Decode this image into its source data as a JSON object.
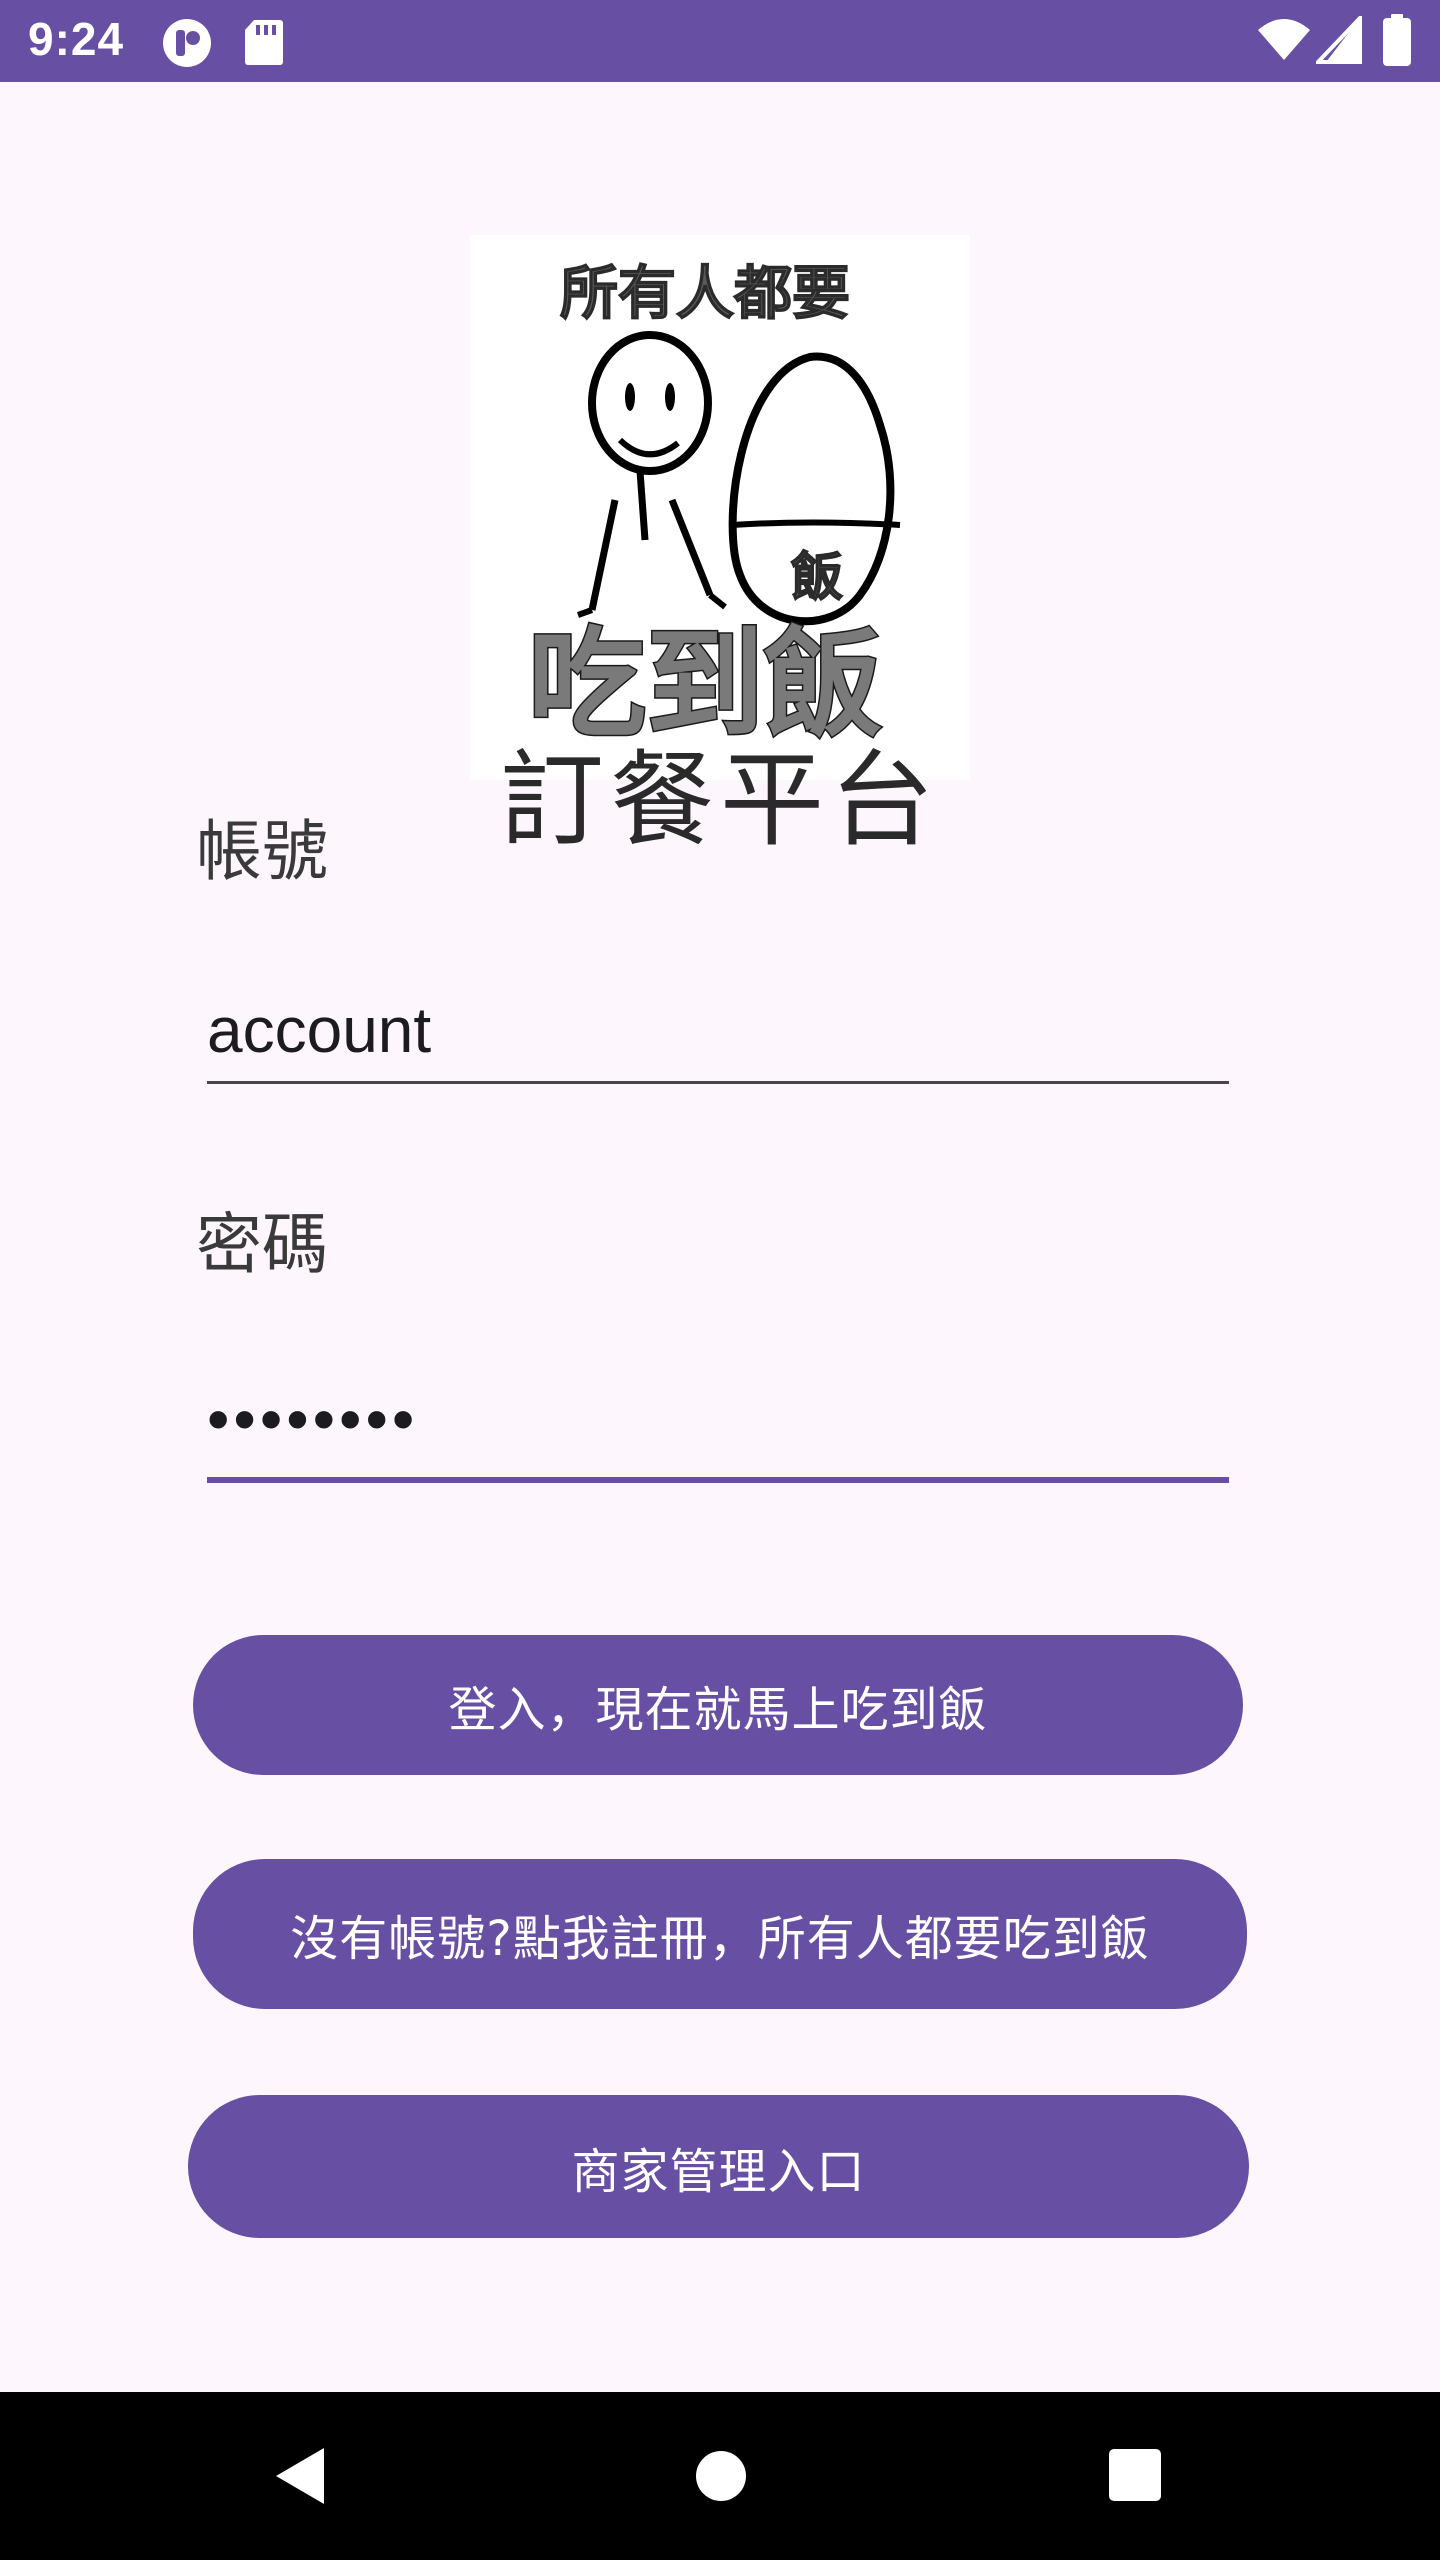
{
  "status_bar": {
    "time": "9:24",
    "icons": [
      "app-notification-icon",
      "sd-card-icon",
      "wifi-icon",
      "signal-icon",
      "battery-icon"
    ]
  },
  "logo": {
    "top_text": "所有人都要",
    "bowl_text": "飯",
    "bottom_text": "吃到飯"
  },
  "title": "訂餐平台",
  "account": {
    "label": "帳號",
    "value": "account"
  },
  "password": {
    "label": "密碼",
    "value": "••••••••"
  },
  "buttons": {
    "login": "登入，現在就馬上吃到飯",
    "register": "沒有帳號?點我註冊，所有人都要吃到飯",
    "merchant": "商家管理入口"
  },
  "colors": {
    "primary": "#6750a4",
    "background": "#fdf7fd"
  },
  "nav_bar": {
    "icons": [
      "back-icon",
      "home-icon",
      "recents-icon"
    ]
  }
}
